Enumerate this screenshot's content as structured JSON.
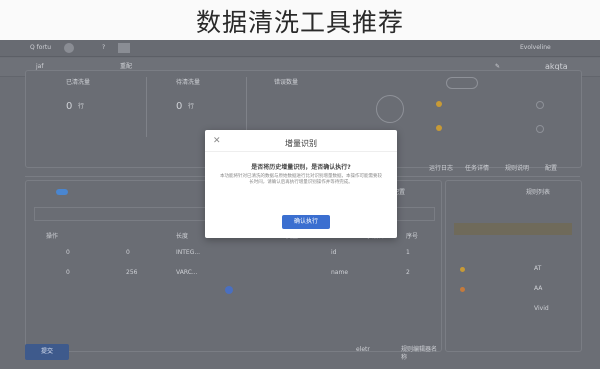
{
  "headline": "数据清洗工具推荐",
  "top": {
    "app_name": "Q fortu",
    "brand": "Evolveline"
  },
  "toolbar": {
    "left_label": "akqta",
    "right_tab": "jaf",
    "mid_label": "重配"
  },
  "modal": {
    "title": "增量识别",
    "question": "是否将历史增量识别，是否确认执行?",
    "body": "本功能将针对已清洗的数据与原始数据进行比对识别增量数据，本操作可能需要较长时间，请确认后再执行增量识别操作并等待完成。",
    "confirm_label": "确认执行"
  },
  "stats": [
    {
      "label": "已清洗量",
      "value": "0",
      "unit": "行"
    },
    {
      "label": "待清洗量",
      "value": "0",
      "unit": "行"
    },
    {
      "label": "错误数量",
      "value": "0",
      "unit": "行"
    }
  ],
  "tabs": [
    "配置",
    "规则说明",
    "任务详情",
    "运行日志",
    "配置管理"
  ],
  "sidebar": {
    "title": "规则列表",
    "items": [
      "AT",
      "AA",
      "Vivid"
    ]
  },
  "table": {
    "title": "规则配置",
    "columns": [
      "序号",
      "字段名",
      "类型",
      "长度",
      "操作"
    ],
    "rows": [
      [
        "1",
        "id",
        "INTEG...",
        "0",
        "0"
      ],
      [
        "2",
        "name",
        "VARC...",
        "256",
        "0"
      ]
    ]
  },
  "footer": {
    "submit_label": "提交",
    "note_label": "规则编辑器名称",
    "note_value": "eletr"
  }
}
